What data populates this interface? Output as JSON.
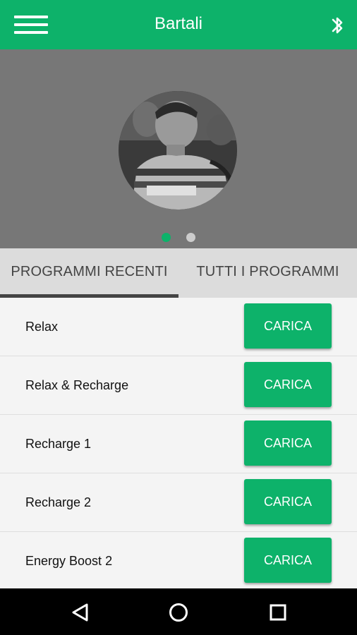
{
  "appbar": {
    "title": "Bartali",
    "menu_icon": "hamburger-menu-icon",
    "bluetooth_icon": "bluetooth-icon"
  },
  "hero": {
    "carousel_page": 1,
    "carousel_count": 2,
    "active_dot_color": "#0db26a",
    "inactive_dot_color": "#cccccc"
  },
  "tabs": [
    {
      "label": "PROGRAMMI RECENTI",
      "selected": true
    },
    {
      "label": "TUTTI I PROGRAMMI",
      "selected": false
    }
  ],
  "programs": [
    {
      "name": "Relax",
      "button": "CARICA"
    },
    {
      "name": "Relax & Recharge",
      "button": "CARICA"
    },
    {
      "name": "Recharge 1",
      "button": "CARICA"
    },
    {
      "name": "Recharge 2",
      "button": "CARICA"
    },
    {
      "name": "Energy Boost 2",
      "button": "CARICA"
    }
  ],
  "navbar": {
    "icons": [
      "back-icon",
      "home-icon",
      "recents-icon"
    ]
  },
  "colors": {
    "accent": "#0db26a",
    "hero_bg": "#777777",
    "tab_bg": "#dcdcdc"
  }
}
